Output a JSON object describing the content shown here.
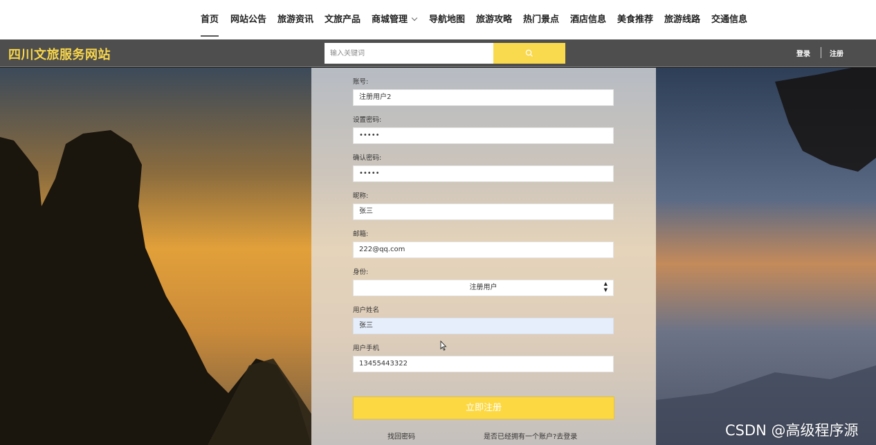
{
  "nav": {
    "items": [
      {
        "label": "首页",
        "active": true
      },
      {
        "label": "网站公告"
      },
      {
        "label": "旅游资讯"
      },
      {
        "label": "文旅产品"
      },
      {
        "label": "商城管理",
        "dropdown": true
      },
      {
        "label": "导航地图"
      },
      {
        "label": "旅游攻略"
      },
      {
        "label": "热门景点"
      },
      {
        "label": "酒店信息"
      },
      {
        "label": "美食推荐"
      },
      {
        "label": "旅游线路"
      },
      {
        "label": "交通信息"
      }
    ]
  },
  "header": {
    "logo": "四川文旅服务网站",
    "search_placeholder": "输入关键词",
    "search_icon": "search-icon",
    "login": "登录",
    "register": "注册"
  },
  "form": {
    "account_label": "账号:",
    "account_value": "注册用户2",
    "password_label": "设置密码:",
    "password_value": "•••••",
    "confirm_label": "确认密码:",
    "confirm_value": "•••••",
    "nickname_label": "昵称:",
    "nickname_value": "张三",
    "email_label": "邮箱:",
    "email_value": "222@qq.com",
    "role_label": "身份:",
    "role_value": "注册用户",
    "realname_label": "用户姓名",
    "realname_value": "张三",
    "phone_label": "用户手机",
    "phone_value": "13455443322",
    "submit": "立即注册",
    "forgot": "找回密码",
    "has_account": "是否已经拥有一个账户?去登录"
  },
  "colors": {
    "accent": "#f9d94e",
    "logo": "#f9d64a",
    "header_bg": "#4e4e4e"
  },
  "watermark": "CSDN @高级程序源"
}
